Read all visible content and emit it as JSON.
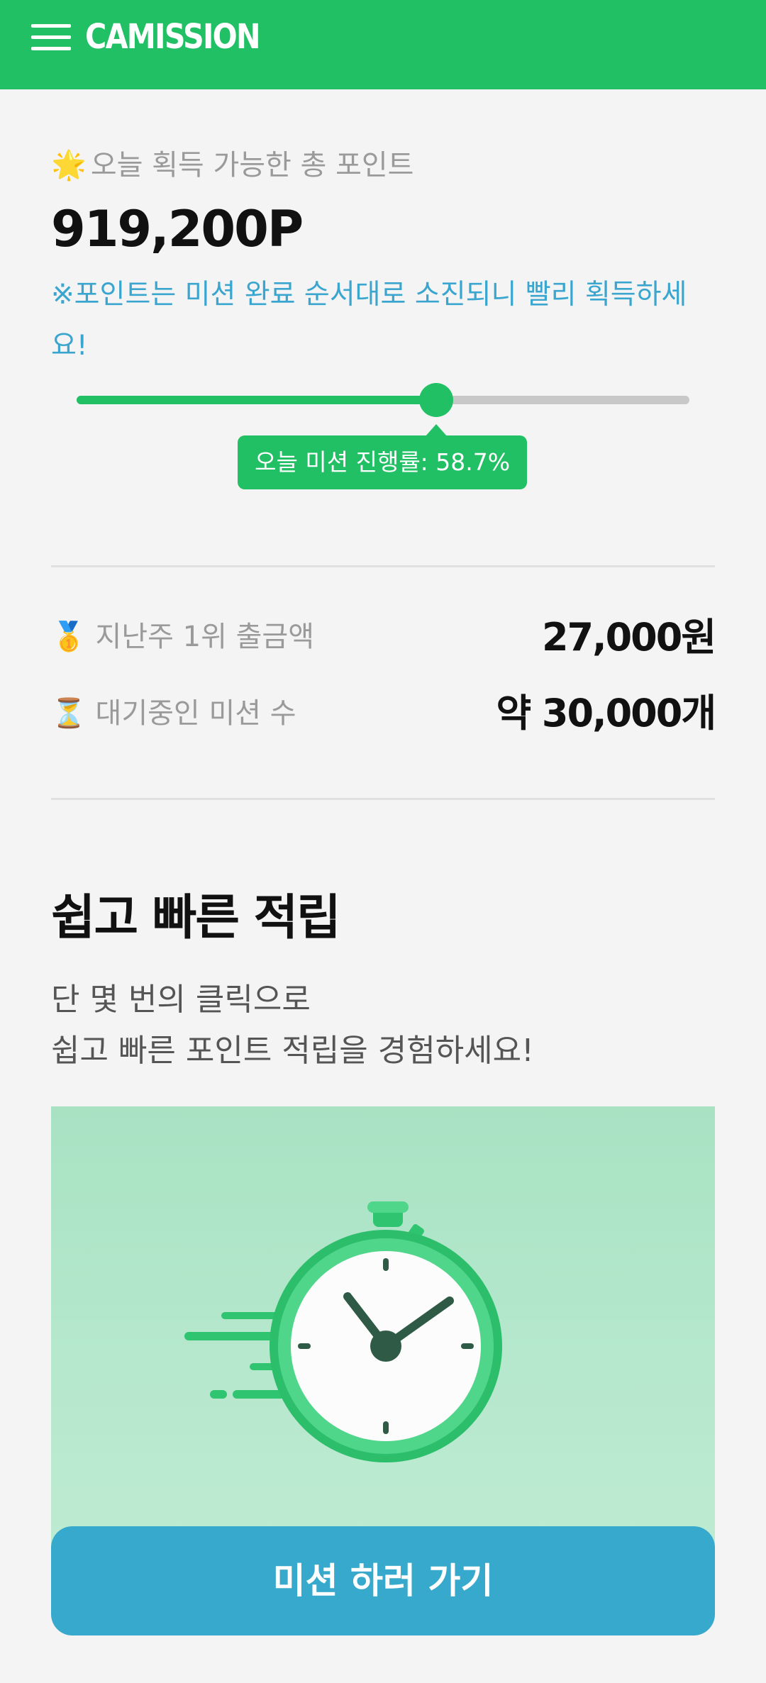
{
  "header": {
    "menu_icon": "hamburger-menu-icon",
    "logo_text": "CAMISSION",
    "brand_color": "#22c065"
  },
  "points": {
    "icon": "sparkle-star-icon",
    "icon_glyph": "🌟",
    "label": "오늘 획득 가능한 총 포인트",
    "value": "919,200P",
    "notice": "※포인트는 미션 완료 순서대로 소진되니 빨리 획득하세요!",
    "notice_color": "#3aa6cf"
  },
  "progress": {
    "fraction": 0.587,
    "tooltip": "오늘 미션 진행률: 58.7%"
  },
  "stats": [
    {
      "icon": "medal-icon",
      "icon_glyph": "🥇",
      "label": "지난주 1위 출금액",
      "value": "27,000원"
    },
    {
      "icon": "hourglass-icon",
      "icon_glyph": "⏳",
      "label": "대기중인 미션 수",
      "value": "약 30,000개"
    }
  ],
  "easy": {
    "title": "쉽고 빠른 적립",
    "desc_line1": "단 몇 번의 클릭으로",
    "desc_line2": "쉽고 빠른 포인트 적립을 경험하세요!",
    "hero_icon": "stopwatch-icon"
  },
  "cta": {
    "label": "미션 하러 가기",
    "color": "#37a9cc"
  }
}
